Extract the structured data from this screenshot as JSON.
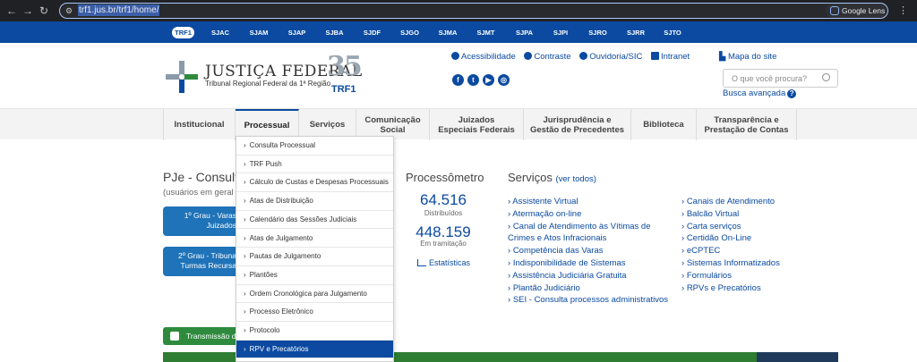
{
  "browser": {
    "url": "trf1.jus.br/trf1/home/",
    "lens_label": "Google Lens"
  },
  "regions": {
    "items": [
      "TRF1",
      "SJAC",
      "SJAM",
      "SJAP",
      "SJBA",
      "SJDF",
      "SJGO",
      "SJMA",
      "SJMT",
      "SJPA",
      "SJPI",
      "SJRO",
      "SJRR",
      "SJTO"
    ],
    "active": "TRF1"
  },
  "header": {
    "brand_title": "JUSTIÇA FEDERAL",
    "brand_subtitle": "Tribunal Regional Federal da 1ª Região",
    "anniversary_number": "35",
    "anniversary_label": "TRF1",
    "access_links": [
      "Acessibilidade",
      "Contraste",
      "Ouvidoria/SIC",
      "Intranet"
    ],
    "social_icons": [
      "facebook-icon",
      "twitter-icon",
      "youtube-icon",
      "instagram-icon"
    ],
    "sitemap_label": "Mapa do site",
    "search_placeholder": "O que você procura?",
    "advanced_search_label": "Busca avançada"
  },
  "mainnav": {
    "items": [
      {
        "label": "Institucional"
      },
      {
        "label": "Processual"
      },
      {
        "label": "Serviços"
      },
      {
        "label": "Comunicação\nSocial"
      },
      {
        "label": "Juizados\nEspeciais Federais"
      },
      {
        "label": "Jurisprudência e\nGestão de Precedentes"
      },
      {
        "label": "Biblioteca"
      },
      {
        "label": "Transparência e\nPrestação de Contas"
      }
    ],
    "active": "Processual"
  },
  "dropdown": {
    "items": [
      "Consulta Processual",
      "TRF Push",
      "Cálculo de Custas e Despesas Processuais",
      "Atas de Distribuição",
      "Calendário das Sessões Judiciais",
      "Atas de Julgamento",
      "Pautas de Julgamento",
      "Plantões",
      "Ordem Cronológica para Julgamento",
      "Processo Eletrônico",
      "Protocolo",
      "RPV e Precatórios"
    ],
    "highlighted": "RPV e Precatórios"
  },
  "pje": {
    "title": "PJe - Consulta",
    "subtitle": "(usuários em geral",
    "btn1_line1": "1º Grau - Varas",
    "btn1_line2": "Juizados",
    "btn2_line1": "2º Grau - Tribuna",
    "btn2_line2": "Turmas Recursa",
    "transmissao_label": "Transmissão d"
  },
  "processometro": {
    "title": "Processômetro",
    "distribuidos_value": "64.516",
    "distribuidos_label": "Distribuídos",
    "tramitacao_value": "448.159",
    "tramitacao_label": "Em tramitação",
    "estatisticas_label": "Estatísticas"
  },
  "servicos": {
    "title": "Serviços",
    "ver_todos": "(ver todos)",
    "col1": [
      "Assistente Virtual",
      "Atermação on-line",
      "Canal de Atendimento às Vítimas de",
      "Crimes e Atos Infracionais",
      "Competência das Varas",
      "Indisponibilidade de Sistemas",
      "Assistência Judiciária Gratuita",
      "Plantão Judiciário",
      "SEI - Consulta processos administrativos"
    ],
    "col2": [
      "Canais de Atendimento",
      "Balcão Virtual",
      "Carta serviços",
      "Certidão On-Line",
      "eCPTEC",
      "Sistemas Informatizados",
      "Formulários",
      "RPVs e Precatórios"
    ]
  },
  "colors": {
    "primary_blue": "#0b4aa0",
    "button_blue": "#1f73b8",
    "green": "#2e8b3d"
  }
}
